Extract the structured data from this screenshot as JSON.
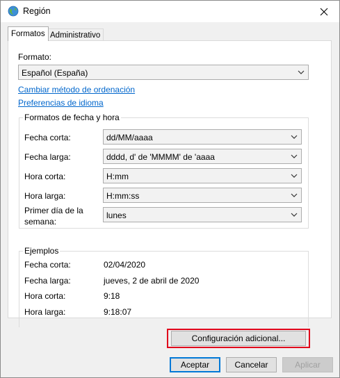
{
  "window": {
    "title": "Región",
    "close_glyph": "✕"
  },
  "tabs": [
    {
      "label": "Formatos",
      "active": true
    },
    {
      "label": "Administrativo",
      "active": false
    }
  ],
  "format": {
    "label": "Formato:",
    "value": "Español (España)",
    "link_sort": "Cambiar método de ordenación",
    "link_language": "Preferencias de idioma"
  },
  "date_time_group": {
    "title": "Formatos de fecha y hora",
    "rows": [
      {
        "label": "Fecha corta:",
        "value": "dd/MM/aaaa"
      },
      {
        "label": "Fecha larga:",
        "value": "dddd, d' de 'MMMM' de 'aaaa"
      },
      {
        "label": "Hora corta:",
        "value": "H:mm"
      },
      {
        "label": "Hora larga:",
        "value": "H:mm:ss"
      }
    ],
    "first_day_label_1": "Primer día de la",
    "first_day_label_2": "semana:",
    "first_day_value": "lunes"
  },
  "examples_group": {
    "title": "Ejemplos",
    "rows": [
      {
        "label": "Fecha corta:",
        "value": "02/04/2020"
      },
      {
        "label": "Fecha larga:",
        "value": "jueves, 2 de abril de 2020"
      },
      {
        "label": "Hora corta:",
        "value": "9:18"
      },
      {
        "label": "Hora larga:",
        "value": "9:18:07"
      }
    ]
  },
  "buttons": {
    "additional": "Configuración adicional...",
    "accept": "Aceptar",
    "cancel": "Cancelar",
    "apply": "Aplicar"
  },
  "colors": {
    "link": "#0066cc",
    "highlight": "#e0001b",
    "default_button_border": "#0078d7"
  }
}
